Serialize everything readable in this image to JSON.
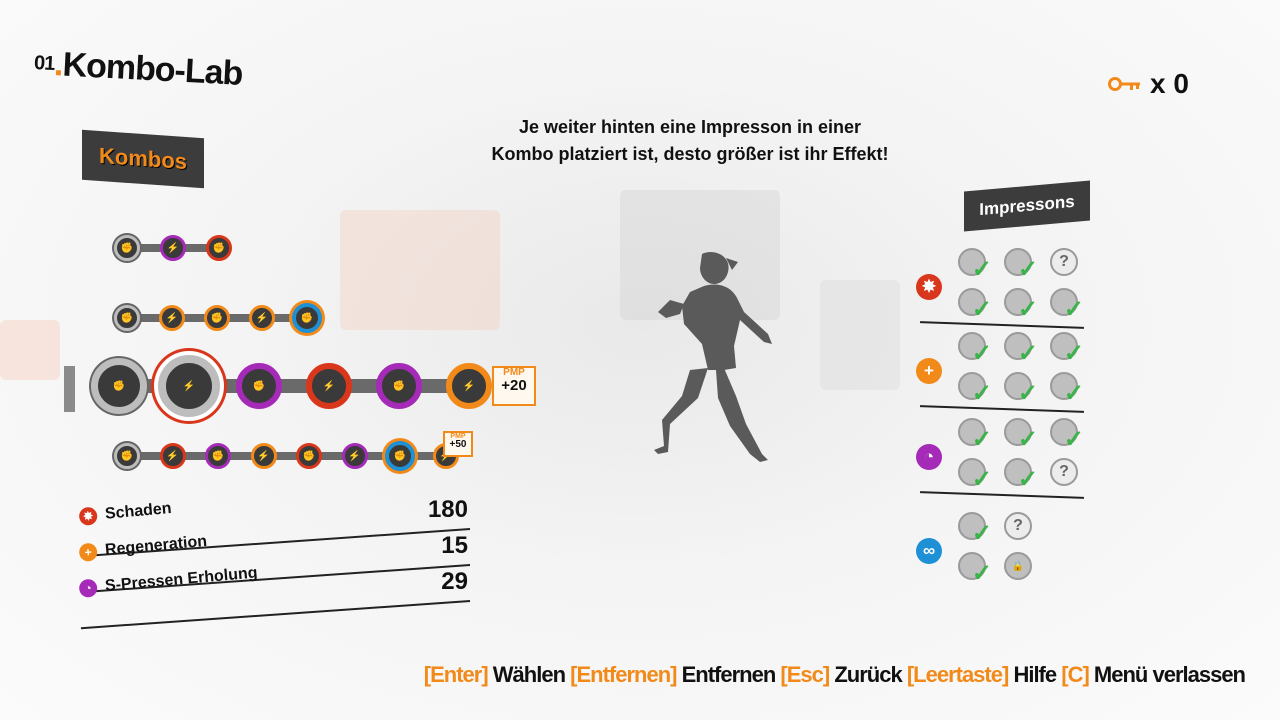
{
  "header": {
    "number": "01",
    "dot": ".",
    "title": "Kombo-Lab"
  },
  "keys": {
    "count_label": "x 0"
  },
  "tabs": {
    "kombos": "Kombos",
    "impressons": "Impressons"
  },
  "hint": {
    "line1": "Je weiter hinten eine Impresson in einer",
    "line2": "Kombo platziert ist, desto größer ist ihr Effekt!"
  },
  "combos": [
    {
      "nodes": [
        "grey",
        "purple",
        "red"
      ],
      "bonus": null
    },
    {
      "nodes": [
        "grey",
        "orange",
        "orange",
        "orange",
        "blue"
      ],
      "bonus": null
    },
    {
      "nodes": [
        "grey",
        "red",
        "purple",
        "red",
        "purple",
        "orange"
      ],
      "bonus": {
        "tag": "PMP",
        "value": "+20"
      },
      "selected": true
    },
    {
      "nodes": [
        "grey",
        "red",
        "purple",
        "orange",
        "red",
        "purple",
        "blue",
        "orange"
      ],
      "bonus": {
        "tag": "PMP",
        "value": "+50"
      }
    }
  ],
  "stats": [
    {
      "label": "Schaden",
      "value": "180",
      "color": "#d9371c",
      "icon": "damage-icon"
    },
    {
      "label": "Regeneration",
      "value": "15",
      "color": "#f28a1a",
      "icon": "regeneration-icon"
    },
    {
      "label": "S-Pressen Erholung",
      "value": "29",
      "color": "#a52ab8",
      "icon": "clock-icon"
    }
  ],
  "impresson_categories": [
    {
      "icon": "damage-icon",
      "color": "#d9371c",
      "slots": [
        "owned",
        "owned",
        "unknown",
        "owned",
        "owned",
        "owned"
      ]
    },
    {
      "icon": "regeneration-icon",
      "color": "#f28a1a",
      "slots": [
        "owned",
        "owned",
        "owned",
        "owned",
        "owned",
        "owned"
      ]
    },
    {
      "icon": "clock-icon",
      "color": "#a52ab8",
      "slots": [
        "owned",
        "owned",
        "owned",
        "owned",
        "owned",
        "unknown"
      ]
    },
    {
      "icon": "link-icon",
      "color": "#1e90d6",
      "slots": [
        "owned",
        "unknown",
        "owned",
        "locked"
      ]
    }
  ],
  "footer": {
    "enter_key": "[Enter]",
    "enter_label": "Wählen",
    "remove_key": "[Entfernen]",
    "remove_label": "Entfernen",
    "esc_key": "[Esc]",
    "esc_label": "Zurück",
    "space_key": "[Leertaste]",
    "space_label": "Hilfe",
    "c_key": "[C]",
    "c_label": "Menü verlassen"
  },
  "colors": {
    "accent": "#f28a1a",
    "red": "#d9371c",
    "purple": "#a52ab8",
    "orange": "#f28a1a",
    "blue": "#1e90d6",
    "grey": "#8a8a8a",
    "check": "#3bb34a"
  }
}
